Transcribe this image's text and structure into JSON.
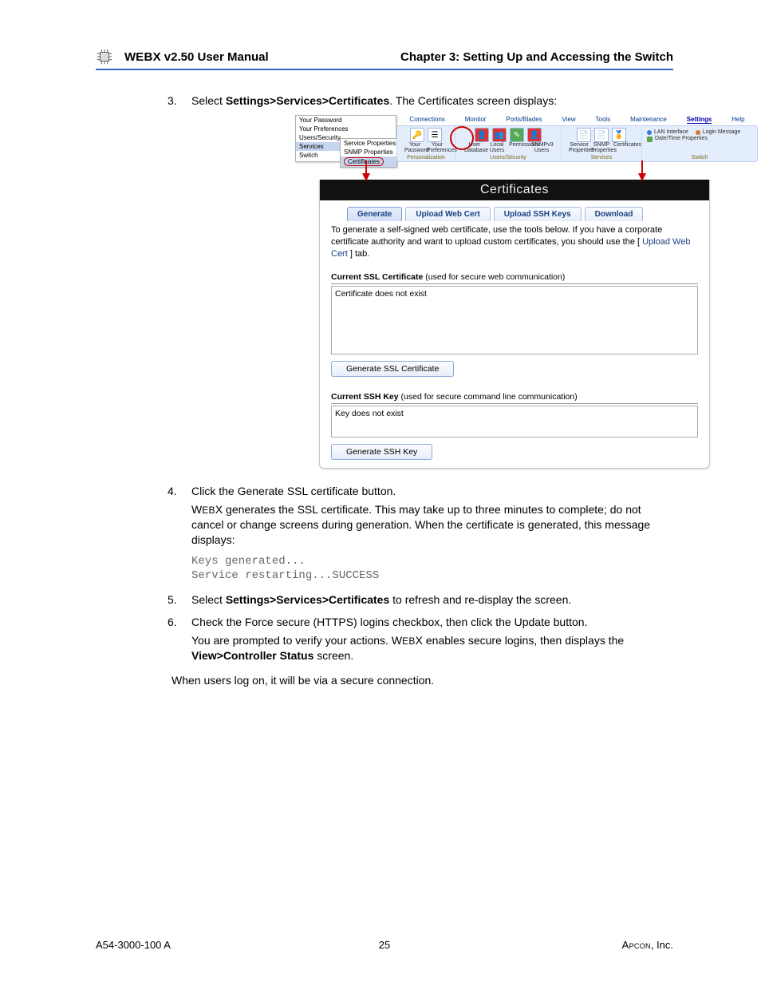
{
  "header": {
    "left_prefix": "W",
    "left_smallcaps": "EB",
    "left_rest": "X v2.50 User Manual",
    "right": "Chapter 3: Setting Up and Accessing the Switch"
  },
  "steps": {
    "s3": {
      "num": "3.",
      "lead": "Select ",
      "path": "Settings>Services>Certificates",
      "tail": ". The Certificates screen displays:"
    },
    "s4": {
      "num": "4.",
      "line1": "Click the Generate SSL certificate button.",
      "para_a": "W",
      "para_sc": "EB",
      "para_b": "X generates the SSL certificate. This may take up to three minutes to complete; do not cancel or change screens during generation. When the certificate is generated, this message displays:",
      "code": "Keys generated...\nService restarting...SUCCESS"
    },
    "s5": {
      "num": "5.",
      "lead": "Select ",
      "path": "Settings>Services>Certificates",
      "tail": " to refresh and re-display the screen."
    },
    "s6": {
      "num": "6.",
      "line1": "Check the Force secure (HTTPS) logins checkbox, then click the Update button.",
      "para_a": "You are prompted to verify your actions. W",
      "para_sc": "EB",
      "para_b": "X enables secure logins, then displays the ",
      "bold": "View>Controller Status",
      "para_c": " screen."
    }
  },
  "closing": "When users log on, it will be via a secure connection.",
  "footer": {
    "left": "A54-3000-100 A",
    "center": "25",
    "right_sc": "Apcon",
    "right_tail": ", Inc."
  },
  "screenshot": {
    "dropdown": {
      "items": [
        "Your Password",
        "Your Preferences",
        "Users/Security",
        "Services",
        "Switch"
      ],
      "sub": [
        "Service Properties",
        "SNMP Properties",
        "Certificates"
      ]
    },
    "menubar": [
      "Connections",
      "Monitor",
      "Ports/Blades",
      "View",
      "Tools",
      "Maintenance",
      "Settings",
      "Help"
    ],
    "menubar_active": "Settings",
    "groups": {
      "g1": {
        "subs": [
          "Your Password",
          "Your Preferences"
        ],
        "footer": "Personalization"
      },
      "g2": {
        "subs": [
          "User Database",
          "Local Users",
          "Permissions",
          "SNMPv3 Users"
        ],
        "footer": "Users/Security"
      },
      "g3": {
        "subs": [
          "Service Properties",
          "SNMP Properties",
          "Certificates"
        ],
        "footer": "Services"
      },
      "g4": {
        "items": [
          "LAN Interface",
          "Login Message",
          "Date/Time Properties"
        ],
        "footer": "Switch"
      }
    },
    "panel": {
      "title": "Certificates",
      "tabs": [
        "Generate",
        "Upload Web Cert",
        "Upload SSH Keys",
        "Download"
      ],
      "intro_a": "To generate a self-signed web certificate, use the tools below. If you have a corporate certificate authority and want to upload custom certificates, you should use the [ ",
      "intro_link": "Upload Web Cert",
      "intro_b": " ] tab.",
      "ssl_head_b": "Current SSL Certificate",
      "ssl_head_t": " (used for secure web communication)",
      "ssl_box": "Certificate does not exist",
      "ssl_btn": "Generate SSL Certificate",
      "ssh_head_b": "Current SSH Key",
      "ssh_head_t": " (used for secure command line communication)",
      "ssh_box": "Key does not exist",
      "ssh_btn": "Generate SSH Key"
    }
  }
}
